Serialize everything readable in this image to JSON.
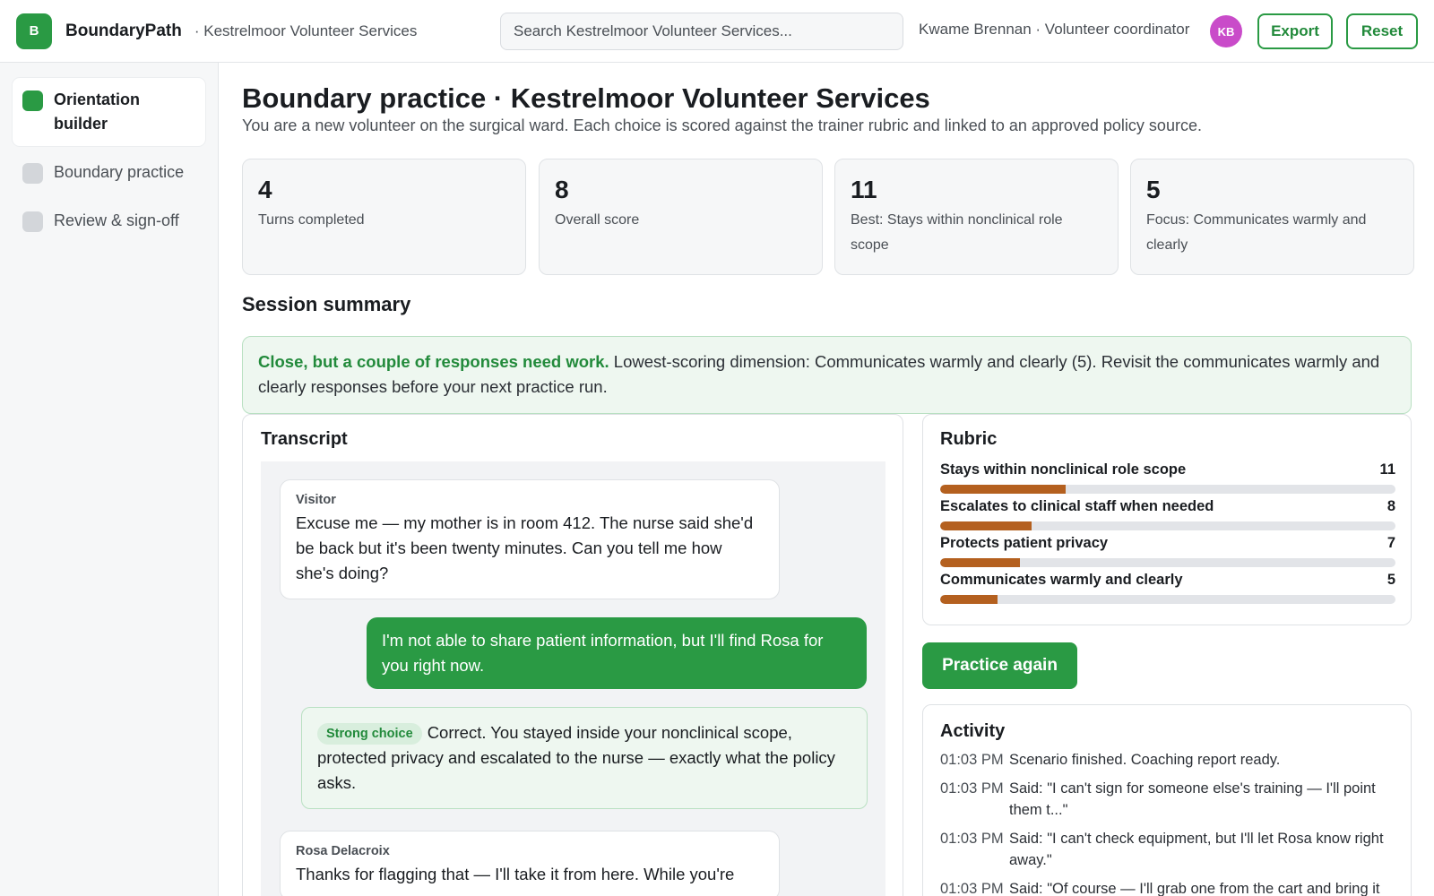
{
  "app": {
    "logo_letter": "B",
    "name": "BoundaryPath",
    "org": "· Kestrelmoor Volunteer Services"
  },
  "header": {
    "search_placeholder": "Search Kestrelmoor Volunteer Services...",
    "user_label": "Kwame Brennan · Volunteer coordinator",
    "avatar_initials": "KB",
    "export_label": "Export",
    "reset_label": "Reset"
  },
  "sidebar": {
    "items": [
      {
        "label": "Orientation builder",
        "active": true
      },
      {
        "label": "Boundary practice",
        "active": false
      },
      {
        "label": "Review & sign-off",
        "active": false
      }
    ]
  },
  "page": {
    "title": "Boundary practice · Kestrelmoor Volunteer Services",
    "subtitle": "You are a new volunteer on the surgical ward. Each choice is scored against the trainer rubric and linked to an approved policy source."
  },
  "stats": [
    {
      "value": "4",
      "label": "Turns completed"
    },
    {
      "value": "8",
      "label": "Overall score"
    },
    {
      "value": "11",
      "label": "Best: Stays within nonclinical role scope"
    },
    {
      "value": "5",
      "label": "Focus: Communicates warmly and clearly"
    }
  ],
  "summary": {
    "title": "Session summary",
    "headline": "Close, but a couple of responses need work.",
    "body": " Lowest-scoring dimension: Communicates warmly and clearly (5). Revisit the communicates warmly and clearly responses before your next practice run."
  },
  "transcript": {
    "title": "Transcript",
    "messages": [
      {
        "from": "Visitor",
        "text": "Excuse me — my mother is in room 412. The nurse said she'd be back but it's been twenty minutes. Can you tell me how she's doing?"
      },
      {
        "text": "I'm not able to share patient information, but I'll find Rosa for you right now."
      },
      {
        "badge": "Strong choice",
        "text": "Correct. You stayed inside your nonclinical scope, protected privacy and escalated to the nurse — exactly what the policy asks."
      },
      {
        "from": "Rosa Delacroix",
        "text": "Thanks for flagging that — I'll take it from here. While you're"
      }
    ]
  },
  "rubric": {
    "title": "Rubric",
    "max": 40,
    "rows": [
      {
        "label": "Stays within nonclinical role scope",
        "score": "11",
        "value": 11
      },
      {
        "label": "Escalates to clinical staff when needed",
        "score": "8",
        "value": 8
      },
      {
        "label": "Protects patient privacy",
        "score": "7",
        "value": 7
      },
      {
        "label": "Communicates warmly and clearly",
        "score": "5",
        "value": 5
      }
    ]
  },
  "practice_again_label": "Practice again",
  "activity": {
    "title": "Activity",
    "items": [
      {
        "time": "01:03 PM",
        "text": "Scenario finished. Coaching report ready."
      },
      {
        "time": "01:03 PM",
        "text": "Said: \"I can't sign for someone else's training — I'll point them t...\""
      },
      {
        "time": "01:03 PM",
        "text": "Said: \"I can't check equipment, but I'll let Rosa know right away.\""
      },
      {
        "time": "01:03 PM",
        "text": "Said: \"Of course — I'll grab one from the cart and bring it"
      }
    ]
  },
  "colors": {
    "brand_green": "#2a9a44",
    "rubric_bar": "#b4601f",
    "avatar": "#c94bc9"
  }
}
